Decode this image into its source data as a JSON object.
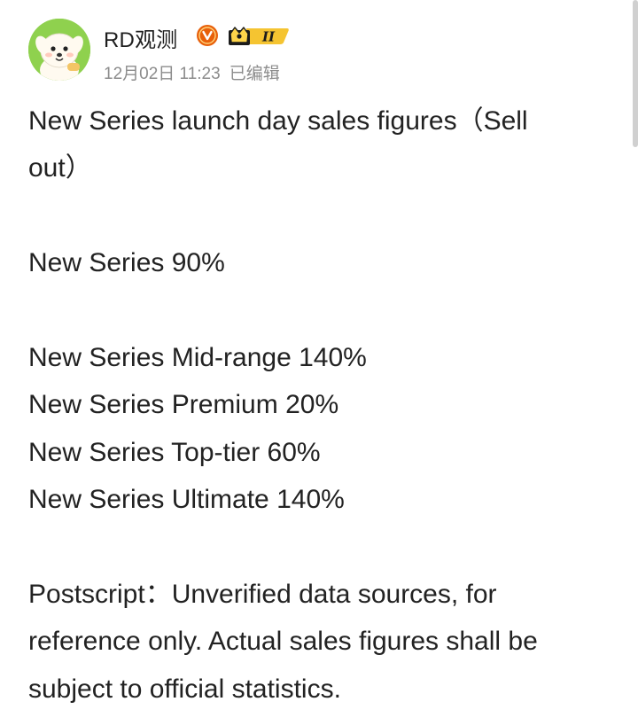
{
  "post": {
    "author": {
      "name": "RD观测",
      "avatar_icon": "cartoon-puppy-avatar",
      "avatar_color": "#8fd14e",
      "verified_color": "#e8600a",
      "crown_badge_label": "II",
      "crown_badge_color": "#f5c431"
    },
    "timestamp": "12月02日 11:23",
    "edited_label": "已编辑",
    "lines": {
      "title_1": "New Series launch day sales figures（Sell",
      "title_2": "out）",
      "series": "New Series 90%",
      "mid_range": "New Series Mid-range 140%",
      "premium": "New Series Premium 20%",
      "top_tier": "New Series Top-tier 60%",
      "ultimate": "New Series Ultimate 140%",
      "postscript_1": "Postscript：Unverified data sources, for",
      "postscript_2": "reference only. Actual sales figures shall be",
      "postscript_3": "subject to official statistics."
    }
  }
}
